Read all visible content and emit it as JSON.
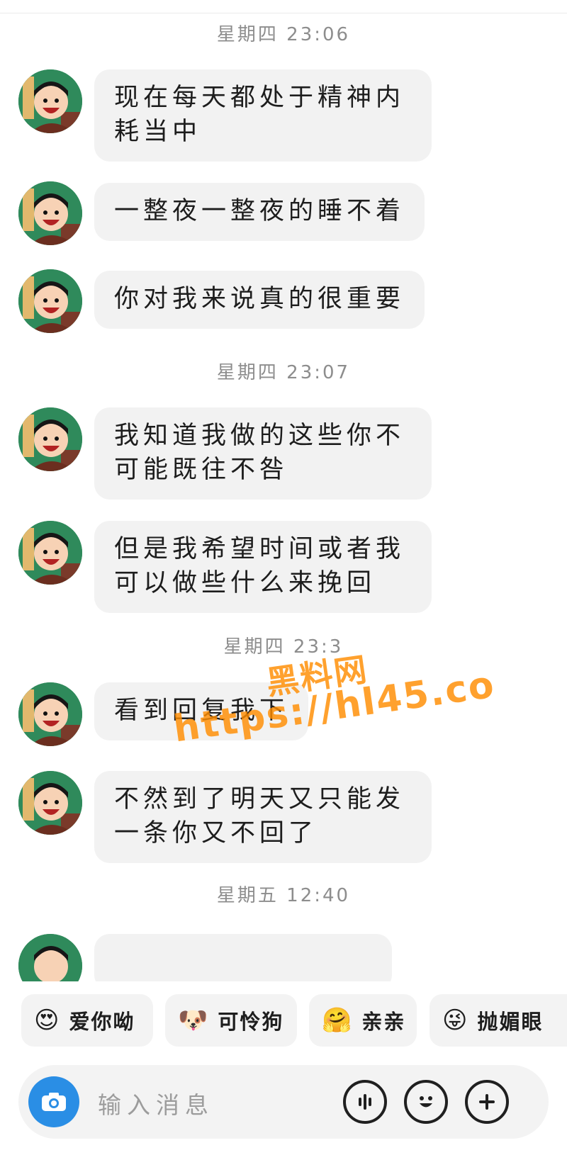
{
  "timestamps": [
    "星期四 23:06",
    "星期四 23:07",
    "星期四 23:3",
    "星期五 12:40"
  ],
  "messages": [
    {
      "text": "现在每天都处于精神内耗当中"
    },
    {
      "text": "一整夜一整夜的睡不着"
    },
    {
      "text": "你对我来说真的很重要"
    },
    {
      "text": "我知道我做的这些你不可能既往不咎"
    },
    {
      "text": "但是我希望时间或者我可以做些什么来挽回"
    },
    {
      "text": "看到回复我下"
    },
    {
      "text": "不然到了明天又只能发一条你又不回了"
    }
  ],
  "quick_replies": [
    {
      "label": "爱你呦",
      "icon": "heart-eyes-emoji-icon",
      "emoji": "😍"
    },
    {
      "label": "可怜狗",
      "icon": "puppy-emoji-icon",
      "emoji": "🐶"
    },
    {
      "label": "亲亲",
      "icon": "hug-emoji-icon",
      "emoji": "🤗"
    },
    {
      "label": "抛媚眼",
      "icon": "wink-emoji-icon",
      "emoji": "😜"
    }
  ],
  "input": {
    "placeholder": "输入消息"
  },
  "watermark": {
    "line1": "黑料网",
    "line2": "https://hl45.co"
  },
  "colors": {
    "camera_button": "#2a8ee5",
    "bubble": "#f2f2f2",
    "watermark": "#ff8c00"
  }
}
